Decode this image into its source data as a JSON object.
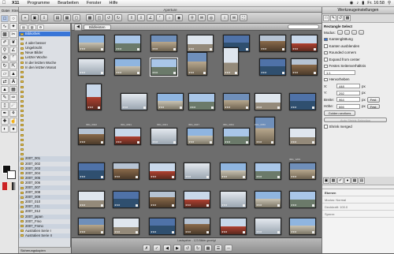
{
  "menubar": {
    "app_name": "X11",
    "menus": [
      "Programme",
      "Bearbeiten",
      "Fenster",
      "Hilfe"
    ],
    "clock": "Fr. 16:58"
  },
  "toolbox": {
    "menus": [
      "Datei",
      "Xtns",
      "Hilfe"
    ]
  },
  "aperture": {
    "title": "Aperture",
    "browser_label": "Bildleisten",
    "status": "Lastspeher - 123 Bilder gezeigt",
    "projects": [
      "Bibliothek",
      "",
      "4 oder besser",
      "Ungelöscht",
      "Neue Bilder",
      "Letzter Woche",
      "In der letzten Woche",
      "In den letzten Monat",
      "",
      "",
      "",
      "",
      "",
      "",
      "",
      "",
      "",
      "",
      "",
      "",
      "",
      "",
      "",
      "",
      "",
      "",
      "2007_001",
      "2007_002",
      "2007_003",
      "2007_004",
      "2007_005",
      "2007_006",
      "2007_007",
      "2007_008",
      "2007_009",
      "2007_010",
      "2007_011",
      "2007_012",
      "2007_japan",
      "2007_Fmo",
      "2007_Fnmo",
      "Australien Serie I",
      "Australien Serie II"
    ],
    "footer": "Sicherungskopien",
    "captions": [
      "IMG_0022",
      "IMG_0091",
      "IMG_0021",
      "IMG_0047",
      "IMG_0031",
      "IMG_0050",
      "IMG_1203"
    ]
  },
  "gimp_options": {
    "window_title": "Werkzeugeinstellungen",
    "tool_name": "Rechteck-Auswahl",
    "tool_title": "Rectangle Select",
    "mode_label": "Modus:",
    "antialias": "Kantenglättung",
    "feather": "Kanten ausblenden",
    "rounded": "Rounded corners",
    "expand": "Expand from center",
    "fixed": "Festes Seitenverhältnis",
    "ratio": "1:1",
    "highlight": "Hervorheben",
    "x_label": "X:",
    "x_value": "448",
    "y_label": "Y:",
    "y_value": "292",
    "width_label": "Breite:",
    "width_value": "964",
    "height_label": "Höhe:",
    "height_value": "666",
    "px": "px",
    "fest": "Fest",
    "guides": "Golden sections",
    "autoshrink": "Auto Shrink Selection",
    "shrink_merged": "Shrink merged",
    "layers_title": "Ebenen",
    "layers_mode": "Modus:",
    "layers_mode_val": "Normal",
    "opacity_label": "Deckkraft:",
    "opacity_val": "100.0",
    "lock_label": "Sperre:"
  },
  "colors": {
    "selection": "#3875d7",
    "folder": "#e6c35a"
  }
}
